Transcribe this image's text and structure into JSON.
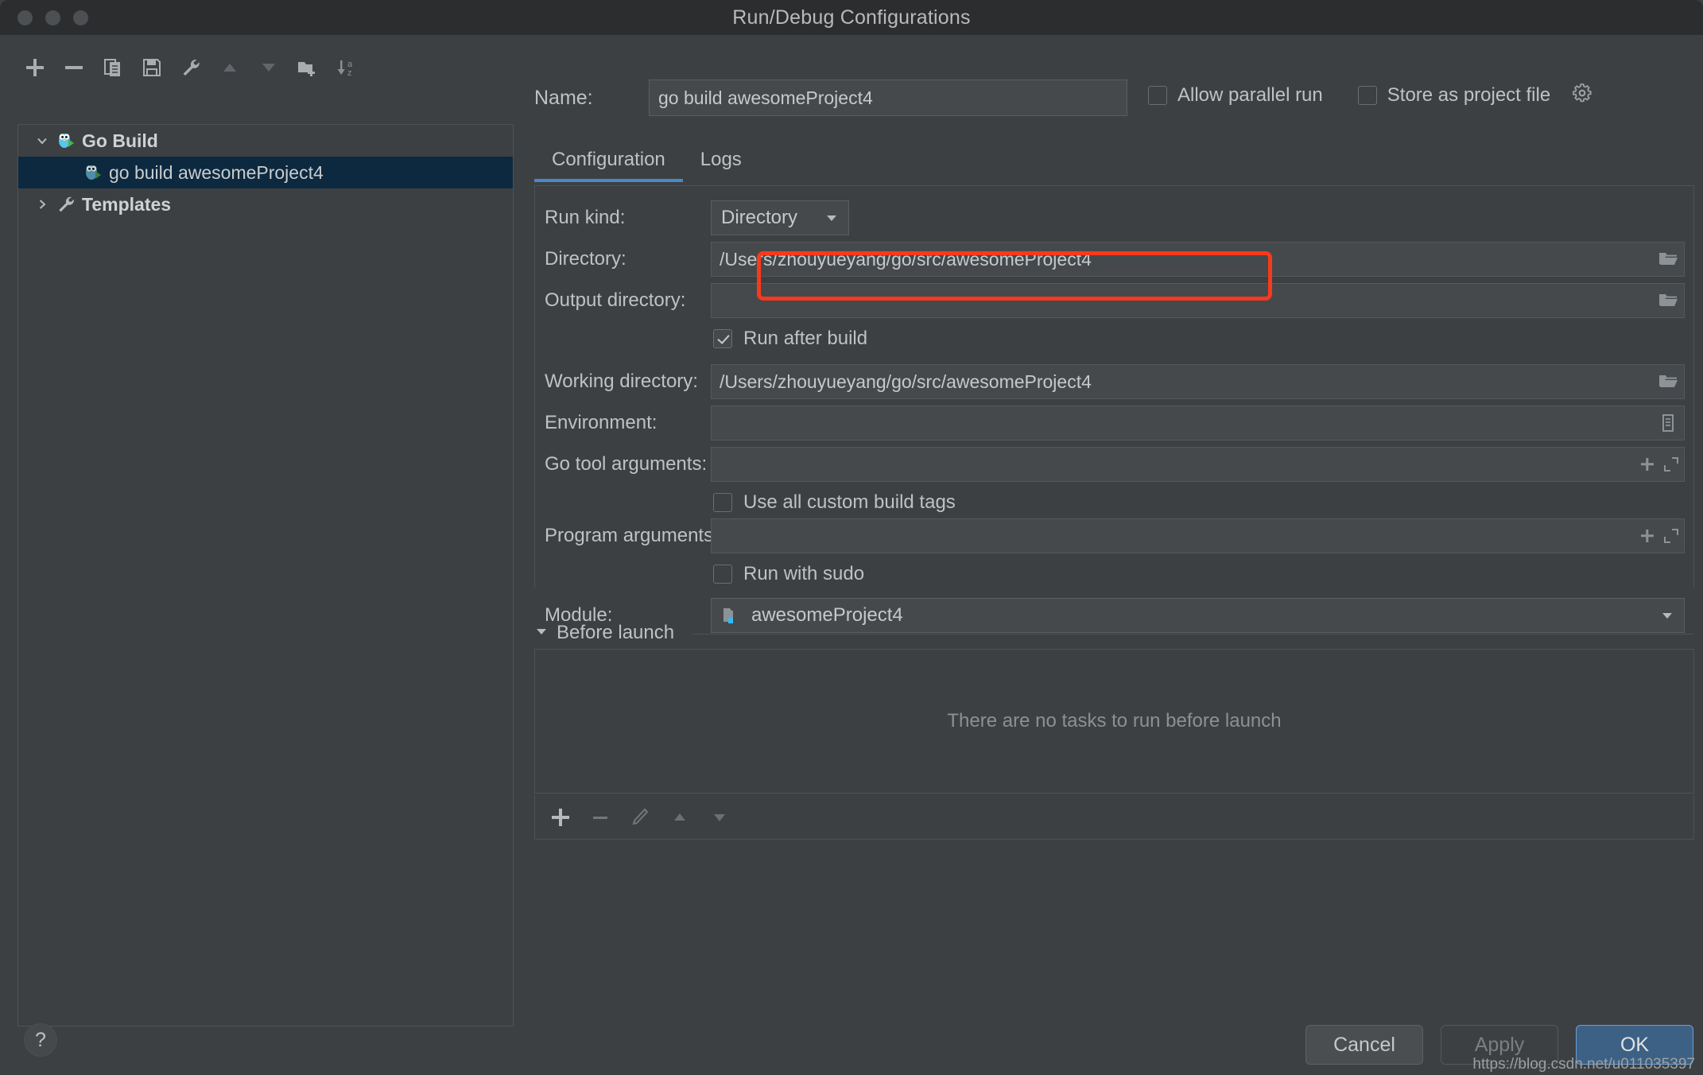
{
  "window": {
    "title": "Run/Debug Configurations",
    "traffic_lights": [
      "close-button",
      "minimize-button",
      "maximize-button"
    ]
  },
  "left_panel": {
    "toolbar": [
      {
        "name": "add-configuration-button",
        "icon": "plus-icon",
        "label": "Add New Configuration"
      },
      {
        "name": "remove-configuration-button",
        "icon": "minus-icon",
        "label": "Remove Configuration"
      },
      {
        "name": "copy-configuration-button",
        "icon": "copy-icon",
        "label": "Copy Configuration"
      },
      {
        "name": "save-configuration-button",
        "icon": "save-icon",
        "label": "Save Configuration"
      },
      {
        "name": "edit-templates-button",
        "icon": "wrench-icon",
        "label": "Edit Templates"
      },
      {
        "name": "move-up-button",
        "icon": "triangle-up-icon",
        "label": "Move Up"
      },
      {
        "name": "move-down-button",
        "icon": "triangle-down-icon",
        "label": "Move Down"
      },
      {
        "name": "new-folder-button",
        "icon": "folder-add-icon",
        "label": "Create New Folder"
      },
      {
        "name": "sort-configurations-button",
        "icon": "sort-az-icon",
        "label": "Sort Configurations"
      }
    ],
    "tree": [
      {
        "label": "Go Build",
        "icon": "go-gopher-icon",
        "expanded": true,
        "level": 0,
        "selected": false,
        "arrow": "chevron-down"
      },
      {
        "label": "go build awesomeProject4",
        "icon": "go-gopher-icon",
        "expanded": false,
        "level": 1,
        "selected": true,
        "arrow": "none"
      },
      {
        "label": "Templates",
        "icon": "wrench-icon",
        "expanded": false,
        "level": 0,
        "selected": false,
        "arrow": "chevron-right"
      }
    ],
    "help_button": "?"
  },
  "header": {
    "name_label": "Name:",
    "name_value": "go build awesomeProject4",
    "name_placeholder": "",
    "allow_parallel_run": {
      "label": "Allow parallel run",
      "checked": false
    },
    "store_as_project_file": {
      "label": "Store as project file",
      "checked": false
    },
    "gear_icon": "gear-icon"
  },
  "tabs": [
    {
      "label": "Configuration",
      "active": true
    },
    {
      "label": "Logs",
      "active": false
    }
  ],
  "form": {
    "run_kind": {
      "label": "Run kind:",
      "value": "Directory"
    },
    "directory": {
      "label": "Directory:",
      "value": "/Users/zhouyueyang/go/src/awesomeProject4",
      "browse_icon": "folder-open-icon",
      "highlighted": true
    },
    "output_directory": {
      "label": "Output directory:",
      "value": "",
      "browse_icon": "folder-open-icon"
    },
    "run_after_build": {
      "label": "Run after build",
      "checked": true
    },
    "working_directory": {
      "label": "Working directory:",
      "value": "/Users/zhouyueyang/go/src/awesomeProject4",
      "browse_icon": "folder-open-icon"
    },
    "environment": {
      "label": "Environment:",
      "value": "",
      "browse_icon": "environment-list-icon"
    },
    "go_tool_arguments": {
      "label": "Go tool arguments:",
      "value": "",
      "icons": [
        "plus-icon",
        "expand-icon"
      ]
    },
    "use_all_custom_build_tags": {
      "label": "Use all custom build tags",
      "checked": false
    },
    "program_arguments": {
      "label": "Program arguments:",
      "value": "",
      "icons": [
        "plus-icon",
        "expand-icon"
      ]
    },
    "run_with_sudo": {
      "label": "Run with sudo",
      "checked": false
    },
    "module": {
      "label": "Module:",
      "value": "awesomeProject4",
      "icon": "module-folder-icon"
    }
  },
  "before_launch": {
    "title": "Before launch",
    "collapse_icon": "triangle-down-icon",
    "empty_message": "There are no tasks to run before launch",
    "toolbar": [
      {
        "name": "add-task-button",
        "icon": "plus-icon"
      },
      {
        "name": "remove-task-button",
        "icon": "minus-icon"
      },
      {
        "name": "edit-task-button",
        "icon": "pencil-icon"
      },
      {
        "name": "move-task-up-button",
        "icon": "triangle-up-icon"
      },
      {
        "name": "move-task-down-button",
        "icon": "triangle-down-icon"
      }
    ]
  },
  "footer": {
    "cancel": "Cancel",
    "apply": "Apply",
    "ok": "OK",
    "watermark": "https://blog.csdn.net/u011035397"
  },
  "colors": {
    "accent": "#4a88c7",
    "selection": "#0d293f",
    "highlight_rect": "#f8391c",
    "primary_button": "#3d6185",
    "window_bg": "#3c4043",
    "titlebar_bg": "#2b2d2f"
  }
}
